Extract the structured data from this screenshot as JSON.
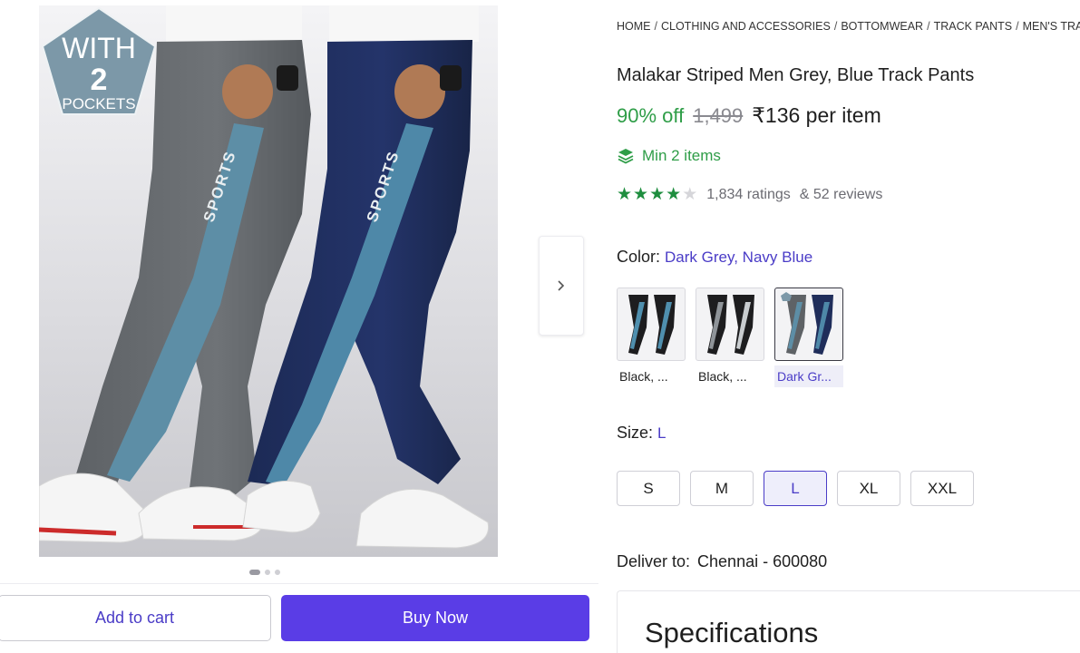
{
  "gallery": {
    "badge": {
      "line1": "WITH",
      "line2": "2",
      "line3": "POCKETS"
    },
    "print_text": "SPORTS",
    "dot_count": 3,
    "active_dot": 0
  },
  "actions": {
    "add_to_cart": "Add to cart",
    "buy_now": "Buy Now"
  },
  "breadcrumb": [
    "HOME",
    "CLOTHING AND ACCESSORIES",
    "BOTTOMWEAR",
    "TRACK PANTS",
    "MEN'S TRA"
  ],
  "product": {
    "title": "Malakar Striped Men Grey, Blue Track Pants",
    "discount": "90% off",
    "mrp": "1,499",
    "price": "₹136 per item",
    "min_items": "Min 2 items",
    "rating_stars": 4,
    "rating_max": 5,
    "ratings_text": "1,834 ratings",
    "reviews_text": "& 52 reviews"
  },
  "color": {
    "label": "Color:",
    "selected": "Dark Grey, Navy Blue",
    "options": [
      {
        "caption": "Black, ...",
        "selected": false
      },
      {
        "caption": "Black, ...",
        "selected": false
      },
      {
        "caption": "Dark Gr...",
        "selected": true
      }
    ]
  },
  "size": {
    "label": "Size:",
    "selected": "L",
    "options": [
      "S",
      "M",
      "L",
      "XL",
      "XXL"
    ]
  },
  "delivery": {
    "label": "Deliver to:",
    "location": "Chennai - 600080"
  },
  "specifications": {
    "title": "Specifications"
  },
  "colors": {
    "accent": "#4a3cc7",
    "buy_button": "#5a3de6",
    "discount_green": "#2e9d47",
    "star_green": "#1e8e3e"
  },
  "icons": {
    "next": "chevron-right-icon",
    "min_items": "layers-icon",
    "star": "star-icon"
  }
}
